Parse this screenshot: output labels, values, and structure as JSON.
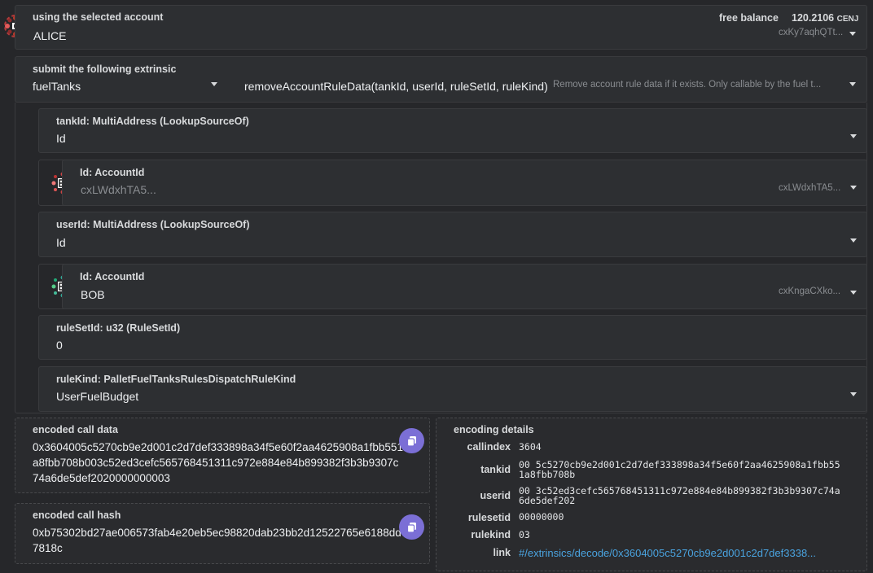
{
  "account": {
    "label": "using the selected account",
    "name": "ALICE",
    "balance_label": "free balance",
    "balance_value": "120.2106",
    "balance_unit": "CENJ",
    "address_short": "cxKy7aqhQTt..."
  },
  "extrinsic": {
    "label": "submit the following extrinsic",
    "pallet": "fuelTanks",
    "method": "removeAccountRuleData(tankId, userId, ruleSetId, ruleKind)",
    "description": "Remove account rule data if it exists. Only callable by the fuel t..."
  },
  "params": {
    "tankId": {
      "label": "tankId: MultiAddress (LookupSourceOf)",
      "value": "Id"
    },
    "tankIdAccount": {
      "label": "Id: AccountId",
      "value": "cxLWdxhTA5...",
      "address_short": "cxLWdxhTA5..."
    },
    "userId": {
      "label": "userId: MultiAddress (LookupSourceOf)",
      "value": "Id"
    },
    "userIdAccount": {
      "label": "Id: AccountId",
      "value": "BOB",
      "address_short": "cxKngaCXko..."
    },
    "ruleSetId": {
      "label": "ruleSetId: u32 (RuleSetId)",
      "value": "0"
    },
    "ruleKind": {
      "label": "ruleKind: PalletFuelTanksRulesDispatchRuleKind",
      "value": "UserFuelBudget"
    }
  },
  "encoded_call_data": {
    "label": "encoded call data",
    "value": "0x3604005c5270cb9e2d001c2d7def333898a34f5e60f2aa4625908a1fbb551a8fbb708b003c52ed3cefc565768451311c972e884e84b899382f3b3b9307c74a6de5def2020000000003"
  },
  "encoded_call_hash": {
    "label": "encoded call hash",
    "value": "0xb75302bd27ae006573fab4e20eb5ec98820dab23bb2d12522765e6188dd7818c"
  },
  "encoding_details": {
    "label": "encoding details",
    "callindex_label": "callindex",
    "callindex": "3604",
    "tankid_label": "tankid",
    "tankid": "00 5c5270cb9e2d001c2d7def333898a34f5e60f2aa4625908a1fbb551a8fbb708b",
    "userid_label": "userid",
    "userid": "00 3c52ed3cefc565768451311c972e884e84b899382f3b3b9307c74a6de5def202",
    "rulesetid_label": "rulesetid",
    "rulesetid": "00000000",
    "rulekind_label": "rulekind",
    "rulekind": "03",
    "link_label": "link",
    "link": "#/extrinsics/decode/0x3604005c5270cb9e2d001c2d7def3338..."
  },
  "colors": {
    "accent": "#7b6fd6",
    "link": "#4aa3df",
    "background": "#26272a"
  }
}
